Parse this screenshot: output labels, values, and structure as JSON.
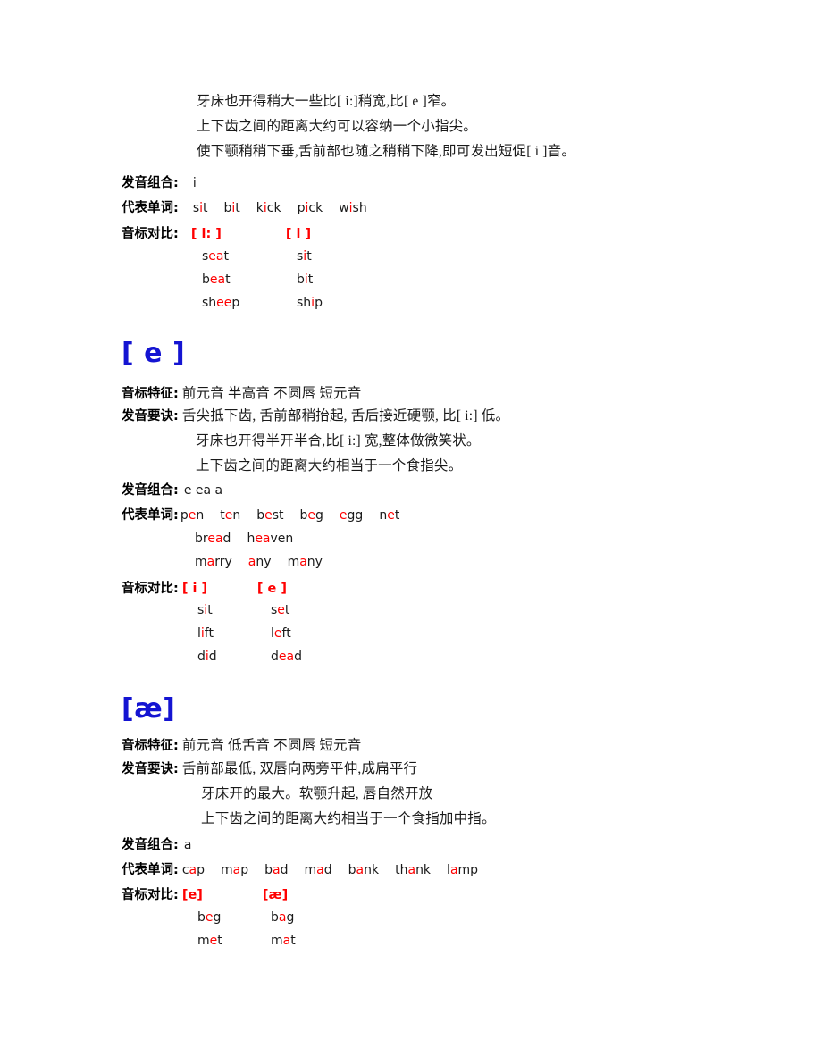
{
  "document": {
    "sections": [
      {
        "id": "section-i-short",
        "heading": null,
        "prose": [
          "牙床也开得稍大一些比[ i:]稍宽,比[ e ]窄。",
          "上下齿之间的距离大约可以容纳一个小指尖。",
          "使下颚稍稍下垂,舌前部也随之稍稍下降,即可发出短促[ i ]音。"
        ],
        "combination_label": "发音组合:",
        "combination_value": "i",
        "words_label": "代表单词:",
        "word_rows": [
          [
            {
              "pre": "s",
              "hl": "i",
              "post": "t"
            },
            {
              "pre": "b",
              "hl": "i",
              "post": "t"
            },
            {
              "pre": "k",
              "hl": "i",
              "post": "ck"
            },
            {
              "pre": "p",
              "hl": "i",
              "post": "ck"
            },
            {
              "pre": "w",
              "hl": "i",
              "post": "sh"
            }
          ]
        ],
        "compare_label": "音标对比:",
        "compare_head_a": "[ i: ]",
        "compare_head_b": "[ i ]",
        "compare_rows": [
          {
            "a": {
              "pre": "s",
              "hl": "ea",
              "post": "t"
            },
            "b": {
              "pre": "s",
              "hl": "i",
              "post": "t"
            }
          },
          {
            "a": {
              "pre": "b",
              "hl": "ea",
              "post": "t"
            },
            "b": {
              "pre": "b",
              "hl": "i",
              "post": "t"
            }
          },
          {
            "a": {
              "pre": "sh",
              "hl": "ee",
              "post": "p"
            },
            "b": {
              "pre": "sh",
              "hl": "i",
              "post": "p"
            }
          }
        ]
      },
      {
        "id": "section-e",
        "heading": "[ e ]",
        "feature_label": "音标特征:",
        "feature_value": "前元音   半高音   不圆唇   短元音",
        "tip_label": "发音要诀:",
        "tip_lines": [
          "舌尖抵下齿, 舌前部稍抬起, 舌后接近硬颚, 比[ i:] 低。",
          "牙床也开得半开半合,比[ i:] 宽,整体做微笑状。",
          "上下齿之间的距离大约相当于一个食指尖。"
        ],
        "combination_label": "发音组合:",
        "combination_value": "e    ea    a",
        "words_label": "代表单词:",
        "word_rows": [
          [
            {
              "pre": "p",
              "hl": "e",
              "post": "n"
            },
            {
              "pre": "t",
              "hl": "e",
              "post": "n"
            },
            {
              "pre": "b",
              "hl": "e",
              "post": "st"
            },
            {
              "pre": "b",
              "hl": "e",
              "post": "g"
            },
            {
              "pre": "",
              "hl": "e",
              "post": "gg"
            },
            {
              "pre": "n",
              "hl": "e",
              "post": "t"
            }
          ],
          [
            {
              "pre": "br",
              "hl": "ea",
              "post": "d"
            },
            {
              "pre": "h",
              "hl": "ea",
              "post": "ven"
            }
          ],
          [
            {
              "pre": "m",
              "hl": "a",
              "post": "rry"
            },
            {
              "pre": "",
              "hl": "a",
              "post": "ny"
            },
            {
              "pre": "m",
              "hl": "a",
              "post": "ny"
            }
          ]
        ],
        "compare_label": "音标对比:",
        "compare_head_a": "[ i ]",
        "compare_head_b": "[ e ]",
        "compare_rows": [
          {
            "a": {
              "pre": "s",
              "hl": "i",
              "post": "t"
            },
            "b": {
              "pre": "s",
              "hl": "e",
              "post": "t"
            }
          },
          {
            "a": {
              "pre": "l",
              "hl": "i",
              "post": "ft"
            },
            "b": {
              "pre": "l",
              "hl": "e",
              "post": "ft"
            }
          },
          {
            "a": {
              "pre": "d",
              "hl": "i",
              "post": "d"
            },
            "b": {
              "pre": "d",
              "hl": "ea",
              "post": "d"
            }
          }
        ]
      },
      {
        "id": "section-ae",
        "heading": "[æ]",
        "feature_label": "音标特征:",
        "feature_value": "前元音   低舌音   不圆唇   短元音",
        "tip_label": "发音要诀:",
        "tip_lines": [
          "舌前部最低, 双唇向两旁平伸,成扁平行",
          "牙床开的最大。软颚升起, 唇自然开放",
          "上下齿之间的距离大约相当于一个食指加中指。"
        ],
        "combination_label": "发音组合:",
        "combination_value": "a",
        "words_label": "代表单词:",
        "word_rows": [
          [
            {
              "pre": "c",
              "hl": "a",
              "post": "p"
            },
            {
              "pre": "m",
              "hl": "a",
              "post": "p"
            },
            {
              "pre": "b",
              "hl": "a",
              "post": "d"
            },
            {
              "pre": "m",
              "hl": "a",
              "post": "d"
            },
            {
              "pre": "b",
              "hl": "a",
              "post": "nk"
            },
            {
              "pre": "th",
              "hl": "a",
              "post": "nk"
            },
            {
              "pre": "l",
              "hl": "a",
              "post": "mp"
            }
          ]
        ],
        "compare_label": "音标对比:",
        "compare_head_a": "[e]",
        "compare_head_b": "[æ]",
        "compare_rows": [
          {
            "a": {
              "pre": "b",
              "hl": "e",
              "post": "g"
            },
            "b": {
              "pre": "b",
              "hl": "a",
              "post": "g"
            }
          },
          {
            "a": {
              "pre": "m",
              "hl": "e",
              "post": "t"
            },
            "b": {
              "pre": "m",
              "hl": "a",
              "post": "t"
            }
          }
        ]
      }
    ],
    "colors": {
      "highlight": "#ff0000",
      "heading": "#1414d2",
      "text": "#1a1a1a"
    }
  }
}
